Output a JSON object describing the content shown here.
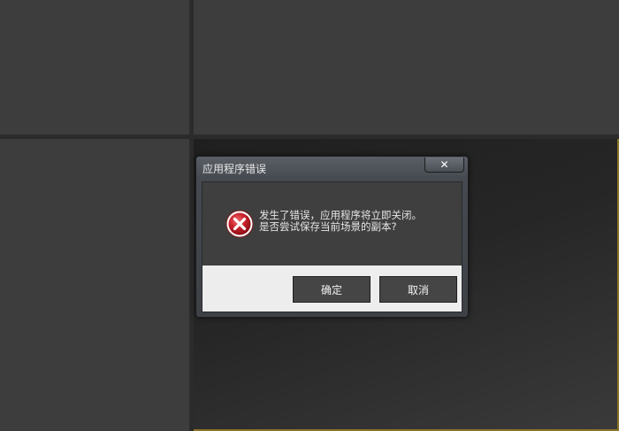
{
  "dialog": {
    "title": "应用程序错误",
    "close_glyph": "✕",
    "message_line1": "发生了错误，应用程序将立即关闭。",
    "message_line2": "是否尝试保存当前场景的副本?",
    "icon": "error-icon",
    "buttons": {
      "ok": "确定",
      "cancel": "取消"
    }
  },
  "colors": {
    "viewport_border_active": "#8a7428",
    "error_icon_fill": "#c8202a",
    "button_bg": "#454545",
    "button_area_bg": "#ededed"
  }
}
